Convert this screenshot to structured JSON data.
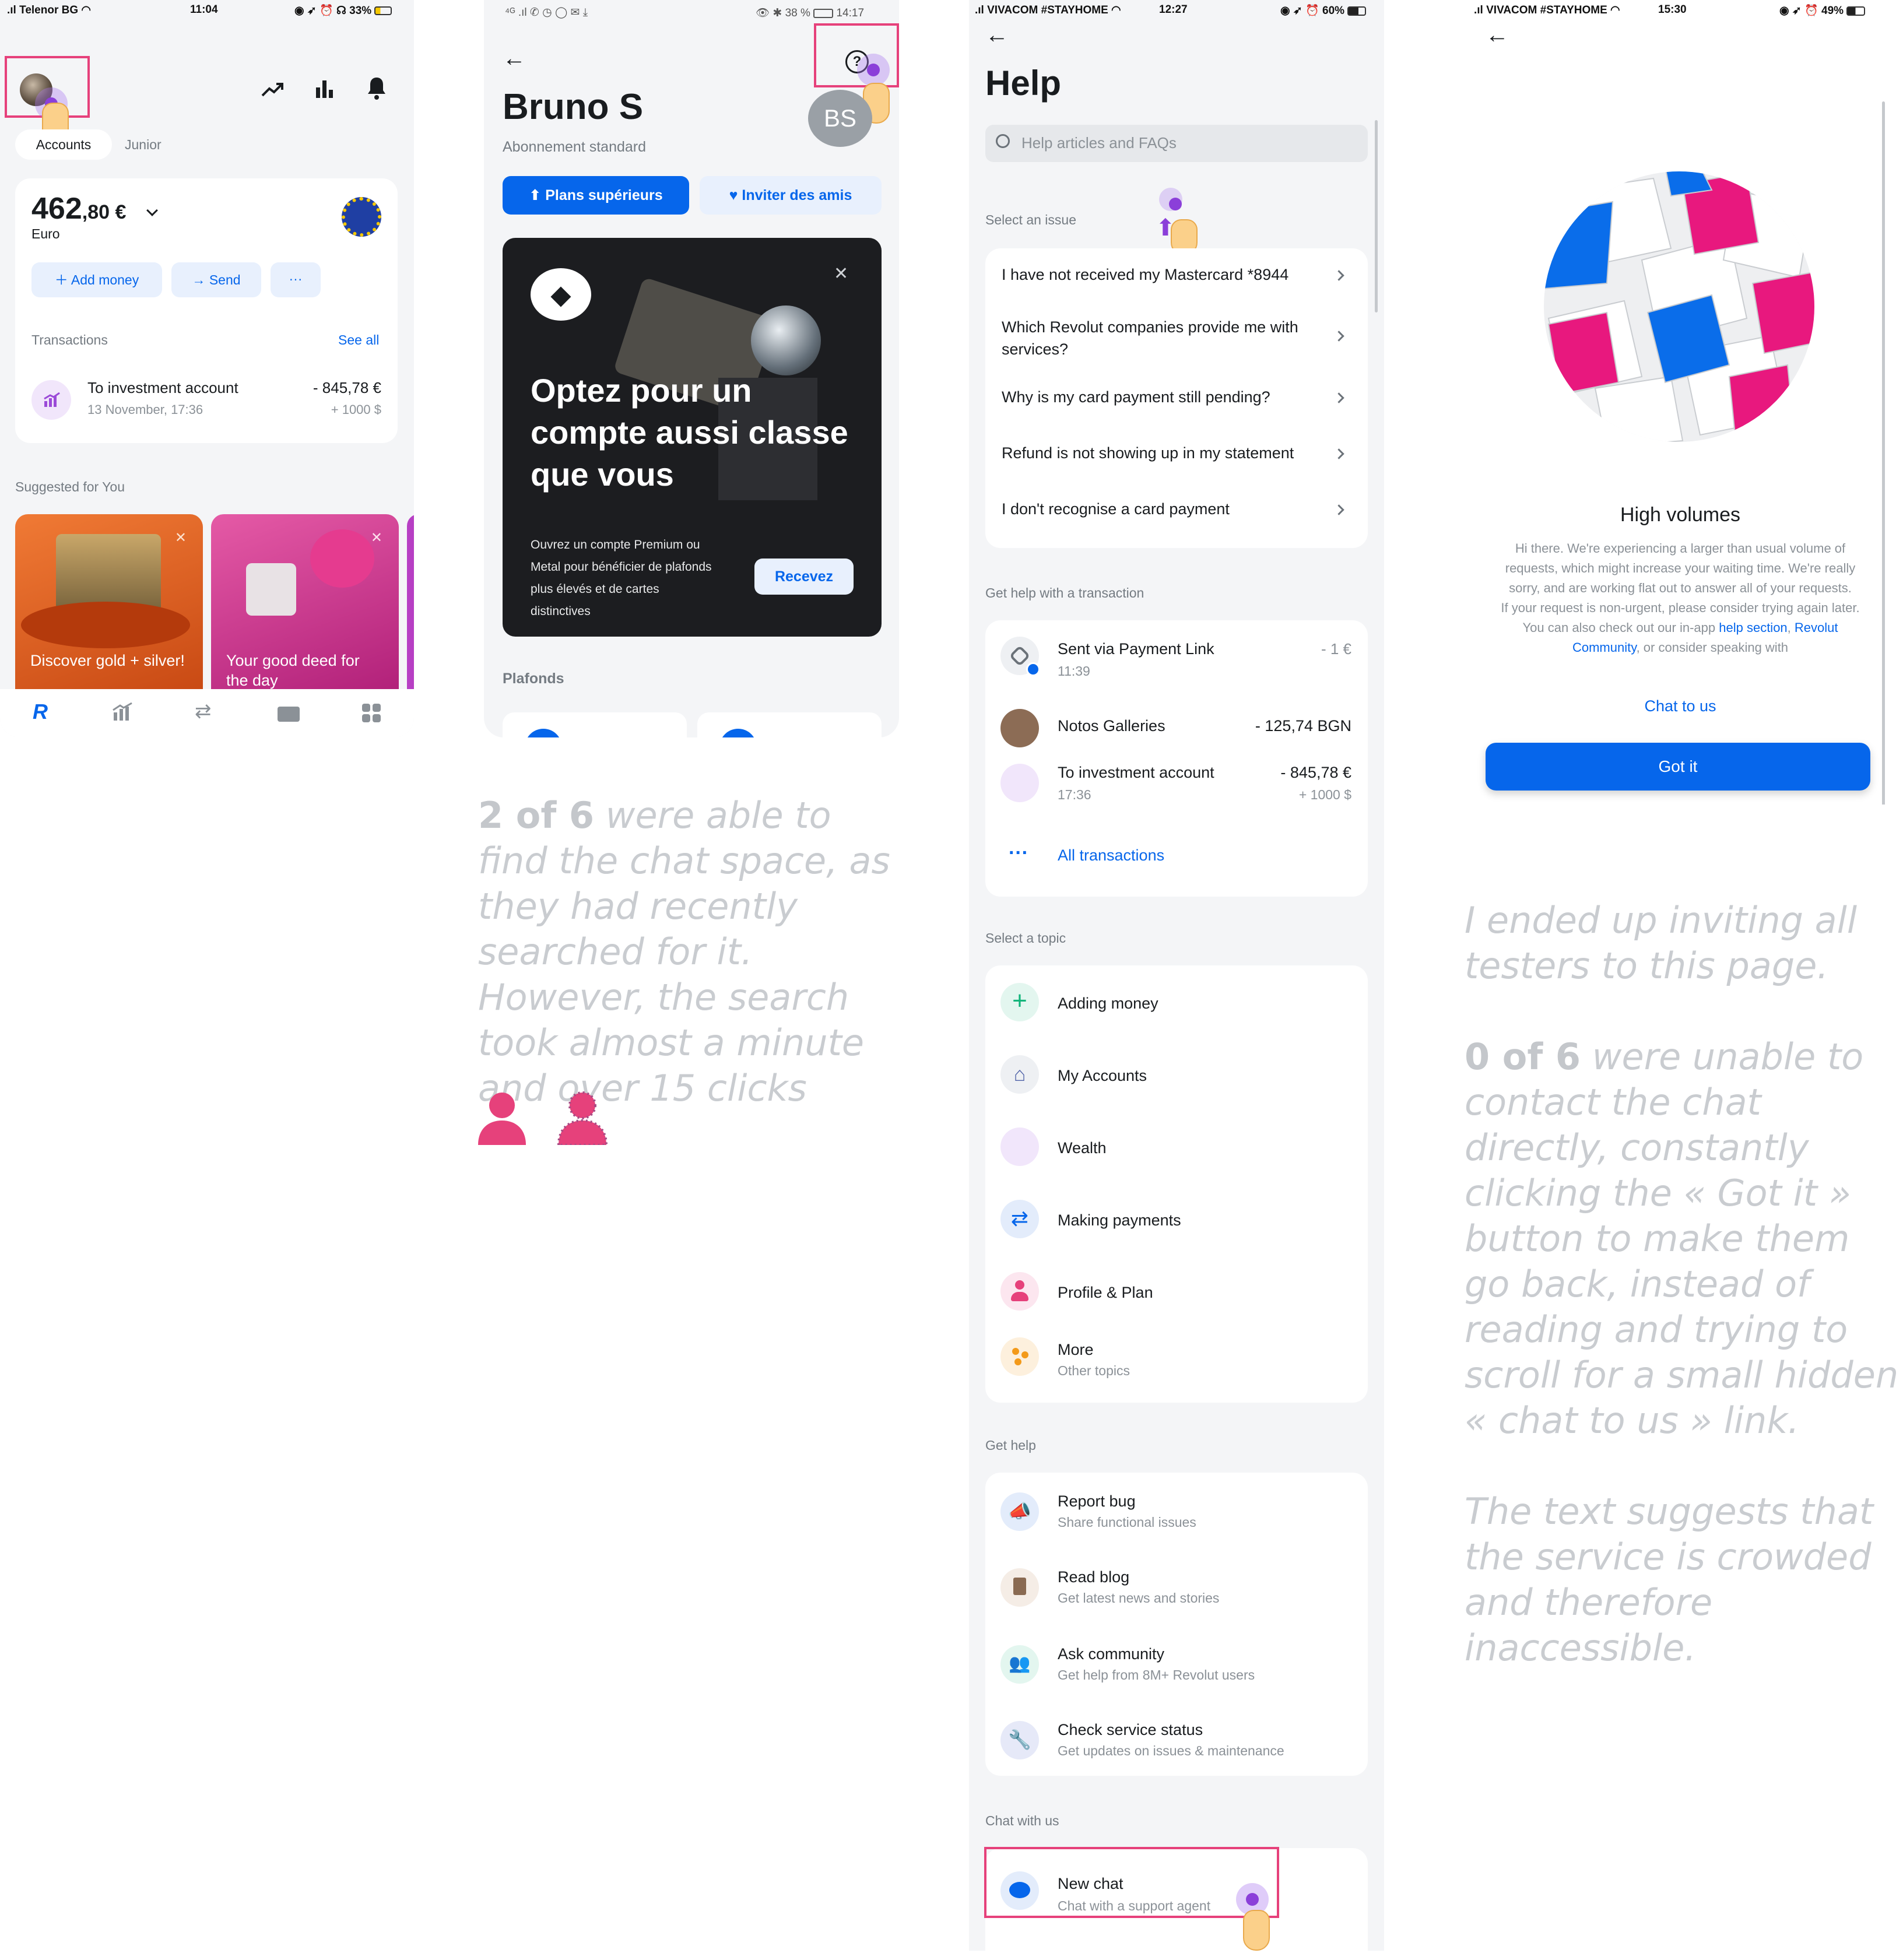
{
  "screen1": {
    "status": {
      "carrier": "Telenor BG",
      "time": "11:04",
      "battery": "33%"
    },
    "tabs": [
      "Accounts",
      "Junior"
    ],
    "balance": {
      "whole": "462",
      "cents": ",80 €",
      "currency": "Euro"
    },
    "buttons": {
      "add": "Add money",
      "send": "Send",
      "more": "···"
    },
    "transactions_label": "Transactions",
    "see_all": "See all",
    "tx": {
      "title": "To investment account",
      "date": "13 November, 17:36",
      "amount": "- 845,78 €",
      "sub": "+ 1000 $"
    },
    "suggested_label": "Suggested for You",
    "cards": [
      "Discover gold + silver!",
      "Your good deed for the day"
    ]
  },
  "screen2": {
    "status": {
      "icons": "⁴ᴳ .ıl ✆ ◷ ◯ ✉ ⤓",
      "battery": "38 %",
      "time": "14:17"
    },
    "name": "Bruno S",
    "avatar": "BS",
    "plan": "Abonnement standard",
    "btn_upgrade": "Plans supérieurs",
    "btn_invite": "Inviter des amis",
    "promo_title": "Optez pour un compte aussi classe que vous",
    "promo_text": "Ouvrez un compte Premium ou Metal pour bénéficier de plafonds plus élevés et de cartes distinctives",
    "promo_cta": "Recevez",
    "limits_label": "Plafonds"
  },
  "note1": {
    "bold": "2 of 6",
    "text": " were able to find the chat space, as they had recently searched for it. However, the search took almost a minute and over 15 clicks"
  },
  "screen3": {
    "status": {
      "carrier": "VIVACOM #STAYHOME",
      "time": "12:27",
      "battery": "60%"
    },
    "title": "Help",
    "search_placeholder": "Help articles and FAQs",
    "issue_label": "Select an issue",
    "issues": [
      "I have not received my Mastercard *8944",
      "Which Revolut companies provide me with services?",
      "Why is my card payment still pending?",
      "Refund is not showing up in my statement",
      "I don't recognise a card payment"
    ],
    "tx_label": "Get help with a transaction",
    "txs": [
      {
        "title": "Sent via Payment Link",
        "sub": "11:39",
        "amount": "- 1 €",
        "amount2": ""
      },
      {
        "title": "Notos Galleries",
        "sub": "",
        "amount": "- 125,74 BGN",
        "amount2": ""
      },
      {
        "title": "To investment account",
        "sub": "17:36",
        "amount": "- 845,78 €",
        "amount2": "+ 1000 $"
      }
    ],
    "all_tx": "All transactions",
    "topic_label": "Select a topic",
    "topics": [
      {
        "title": "Adding money",
        "sub": ""
      },
      {
        "title": "My Accounts",
        "sub": ""
      },
      {
        "title": "Wealth",
        "sub": ""
      },
      {
        "title": "Making payments",
        "sub": ""
      },
      {
        "title": "Profile & Plan",
        "sub": ""
      },
      {
        "title": "More",
        "sub": "Other topics"
      }
    ],
    "gethelp_label": "Get help",
    "help": [
      {
        "title": "Report bug",
        "sub": "Share functional issues"
      },
      {
        "title": "Read blog",
        "sub": "Get latest news and stories"
      },
      {
        "title": "Ask community",
        "sub": "Get help from 8M+ Revolut users"
      },
      {
        "title": "Check service status",
        "sub": "Get updates on issues & maintenance"
      }
    ],
    "chat_label": "Chat with us",
    "chat": {
      "title": "New chat",
      "sub": "Chat with a support agent"
    }
  },
  "screen4": {
    "status": {
      "carrier": "VIVACOM #STAYHOME",
      "time": "15:30",
      "battery": "49%"
    },
    "title": "High volumes",
    "body_a": "Hi there. We're experiencing a larger than usual volume of requests, which might increase your waiting time. We're really sorry, and are working flat out to answer all of your requests.",
    "body_b": "If your request is non-urgent, please consider trying again later. You can also check out our in-app ",
    "link_help": "help section",
    "link_comm": "Revolut Community",
    "body_c": ", or consider speaking with",
    "chat_link": "Chat to us",
    "got_it": "Got it"
  },
  "note2": {
    "line1": "I ended up inviting all testers to this page.",
    "bold": "0 of 6",
    "text": " were unable to contact the chat directly, constantly clicking the « Got it » button to make them go back, instead of reading and trying to scroll for a small hidden « chat to us » link.",
    "line3": "The text suggests that the service is crowded and therefore inaccessible."
  },
  "colors": {
    "accent": "#0666eb",
    "pink": "#e6417b",
    "purple": "#8b3fd9",
    "bg": "#f4f5f7"
  }
}
